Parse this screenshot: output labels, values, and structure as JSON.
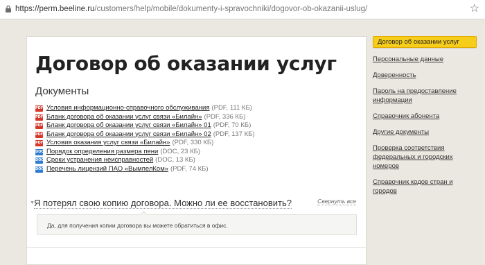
{
  "browser": {
    "url_host": "https://perm.beeline.ru",
    "url_path": "/customers/help/mobile/dokumenty-i-spravochniki/dogovor-ob-okazanii-uslug/"
  },
  "page": {
    "title": "Договор об оказании услуг",
    "subtitle": "Документы"
  },
  "documents": [
    {
      "icon": "pdf",
      "label": "Условия информационно-справочного обслуживания",
      "meta": "(PDF, 111 КБ)"
    },
    {
      "icon": "pdf",
      "label": "Бланк договора об оказании услуг связи «Билайн»",
      "meta": "(PDF, 336 КБ)"
    },
    {
      "icon": "pdf",
      "label": "Бланк договора об оказании услуг связи «Билайн» 01",
      "meta": "(PDF, 70 КБ)"
    },
    {
      "icon": "pdf",
      "label": "Бланк договора об оказании услуг связи «Билайн» 02",
      "meta": "(PDF, 137 КБ)"
    },
    {
      "icon": "pdf",
      "label": "Условия оказания услуг связи «Билайн»",
      "meta": "(PDF, 330 КБ)"
    },
    {
      "icon": "doc",
      "label": "Порядок определения размера пени",
      "meta": "(DOC, 23 КБ)"
    },
    {
      "icon": "doc",
      "label": "Сроки устранения неисправностей",
      "meta": "(DOC, 13 КБ)"
    },
    {
      "icon": "doc",
      "label": "Перечень лицензий ПАО «ВымпелКом»",
      "meta": "(PDF, 74 КБ)"
    }
  ],
  "faq": {
    "question": "Я потерял свою копию договора. Можно ли ее восстановить?",
    "collapse_all": "Свернуть все",
    "answer": "Да, для получения копии договора вы можете обратиться в офис."
  },
  "sidebar": {
    "active": "Договор об оказании услуг",
    "items": [
      "Персональные данные",
      "Доверенность",
      "Пароль на предоставление информации",
      "Справочник абонента",
      "Другие документы",
      "Проверка соответствия федеральных и городских номеров",
      "Справочник кодов стран и городов"
    ]
  },
  "colors": {
    "accent": "#f7cd1b",
    "page_bg": "#ebe8e1",
    "pdf_icon": "#d5372b",
    "doc_icon": "#2f7cd3"
  }
}
